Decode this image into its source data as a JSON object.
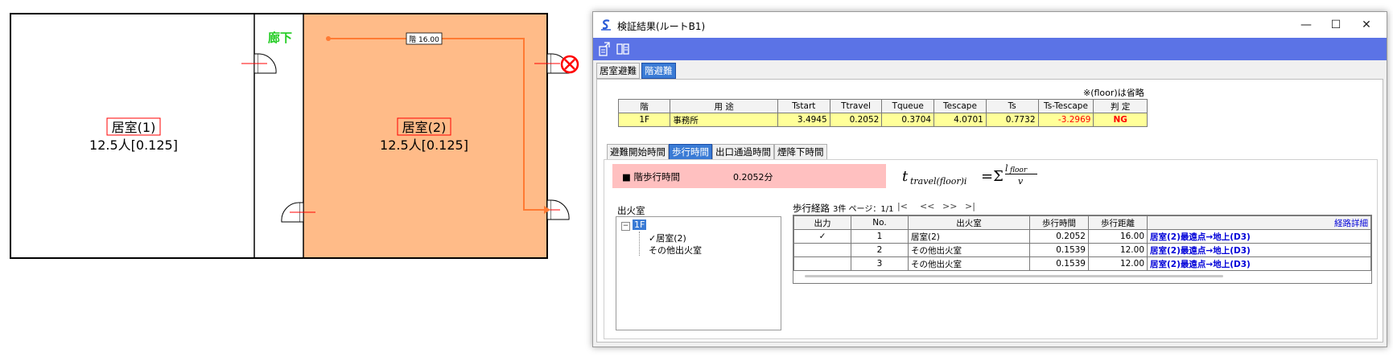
{
  "plan": {
    "corridor_label": "廊下",
    "floor_label": "階 16.00",
    "room1": {
      "name": "居室(1)",
      "occupancy": "12.5人[0.125]"
    },
    "room2": {
      "name": "居室(2)",
      "occupancy": "12.5人[0.125]"
    },
    "colors": {
      "room2_fill": "#ffbb88",
      "route": "#ff7a33",
      "corridor_label": "#22cc22",
      "ng_mark": "#ff0000"
    }
  },
  "window": {
    "title": "検証結果(ルートB1)",
    "controls": [
      "—",
      "☐",
      "✕"
    ],
    "tabs": [
      "居室避難",
      "階避難"
    ],
    "note": "※(floor)は省略",
    "summary": {
      "headers": [
        "階",
        "用 途",
        "Tstart",
        "Ttravel",
        "Tqueue",
        "Tescape",
        "Ts",
        "Ts-Tescape",
        "判 定"
      ],
      "row": [
        "1F",
        "事務所",
        "3.4945",
        "0.2052",
        "0.3704",
        "4.0701",
        "0.7732",
        "-3.2969",
        "NG"
      ]
    },
    "subtabs": [
      "避難開始時間",
      "歩行時間",
      "出口通過時間",
      "煙降下時間"
    ],
    "walk_label": "■ 階歩行時間",
    "walk_value": "0.2052分",
    "formula": {
      "t": "t",
      "sub": "travel(floor)i",
      "eq": "=Σ",
      "num": "l",
      "num_sub": "floor",
      "den": "v"
    },
    "fire_room_label": "出火室",
    "tree": {
      "root": "1F",
      "children": [
        "✓居室(2)",
        "その他出火室"
      ]
    },
    "route_label": "歩行経路",
    "route_count": "3件 ページ：1/1",
    "pager": [
      "|<",
      "<<",
      ">>",
      ">|"
    ],
    "routes": {
      "headers": [
        "出力",
        "No.",
        "出火室",
        "歩行時間",
        "歩行距離",
        "経路詳細"
      ],
      "rows": [
        {
          "out": "✓",
          "no": "1",
          "room": "居室(2)",
          "time": "0.2052",
          "dist": "16.00",
          "detail": "居室(2)最遠点→地上(D3)"
        },
        {
          "out": "",
          "no": "2",
          "room": "その他出火室",
          "time": "0.1539",
          "dist": "12.00",
          "detail": "居室(2)最遠点→地上(D3)"
        },
        {
          "out": "",
          "no": "3",
          "room": "その他出火室",
          "time": "0.1539",
          "dist": "12.00",
          "detail": "居室(2)最遠点→地上(D3)"
        }
      ]
    },
    "colors": {
      "toolbar": "#5b73e6",
      "summary_row": "#ffff99",
      "walk_bg": "#ffc0c0",
      "ng": "#ff0000",
      "negative": "#ff0000",
      "tree_root_bg": "#3a7bd5"
    }
  }
}
